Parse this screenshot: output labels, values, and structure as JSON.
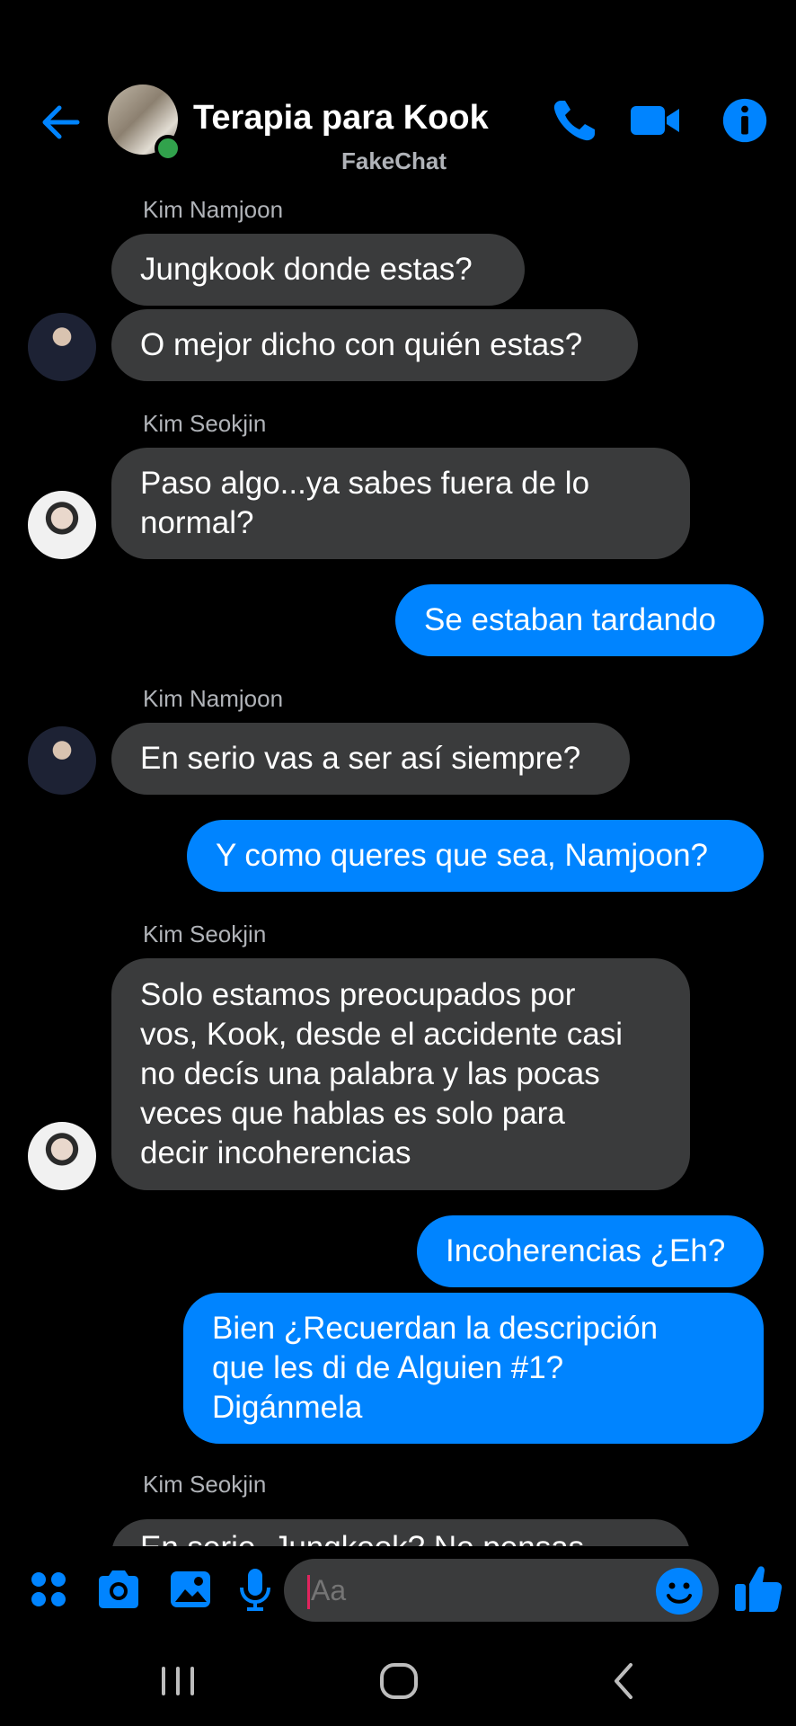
{
  "header": {
    "title": "Terapia para Kook",
    "subtitle": "FakeChat",
    "icons": [
      "back-arrow-icon",
      "phone-icon",
      "video-icon",
      "info-icon"
    ],
    "accent": "#0084ff",
    "online_color": "#31a24c"
  },
  "messages": [
    {
      "sender": "Kim Namjoon"
    },
    {
      "text": "Jungkook donde estas?"
    },
    {
      "text": "O mejor dicho con quién estas?"
    },
    {
      "sender": "Kim Seokjin"
    },
    {
      "text_lines": [
        "Paso algo...ya sabes fuera de lo",
        "normal?"
      ]
    },
    {
      "text": "Se estaban tardando"
    },
    {
      "sender": "Kim Namjoon"
    },
    {
      "text": "En serio vas a ser así siempre?"
    },
    {
      "text": "Y como queres que sea, Namjoon?"
    },
    {
      "sender": "Kim Seokjin"
    },
    {
      "text_lines": [
        "Solo estamos preocupados por",
        "vos, Kook, desde el accidente casi",
        "no decís una palabra y las pocas",
        "veces que hablas es solo para",
        "decir incoherencias"
      ]
    },
    {
      "text": "Incoherencias ¿Eh?"
    },
    {
      "text_lines": [
        "Bien ¿Recuerdan la descripción",
        "que les di de Alguien #1?",
        "Digánmela"
      ]
    },
    {
      "sender": "Kim Seokjin"
    },
    {
      "text": "En serio, Jungkook? No pensas"
    }
  ],
  "composer": {
    "placeholder": "Aa",
    "icons": [
      "apps-icon",
      "camera-icon",
      "gallery-icon",
      "mic-icon",
      "emoji-icon",
      "thumbs-up-icon"
    ]
  },
  "colors": {
    "incoming_bubble": "#3a3b3c",
    "outgoing_bubble": "#0084ff",
    "background": "#000000"
  }
}
